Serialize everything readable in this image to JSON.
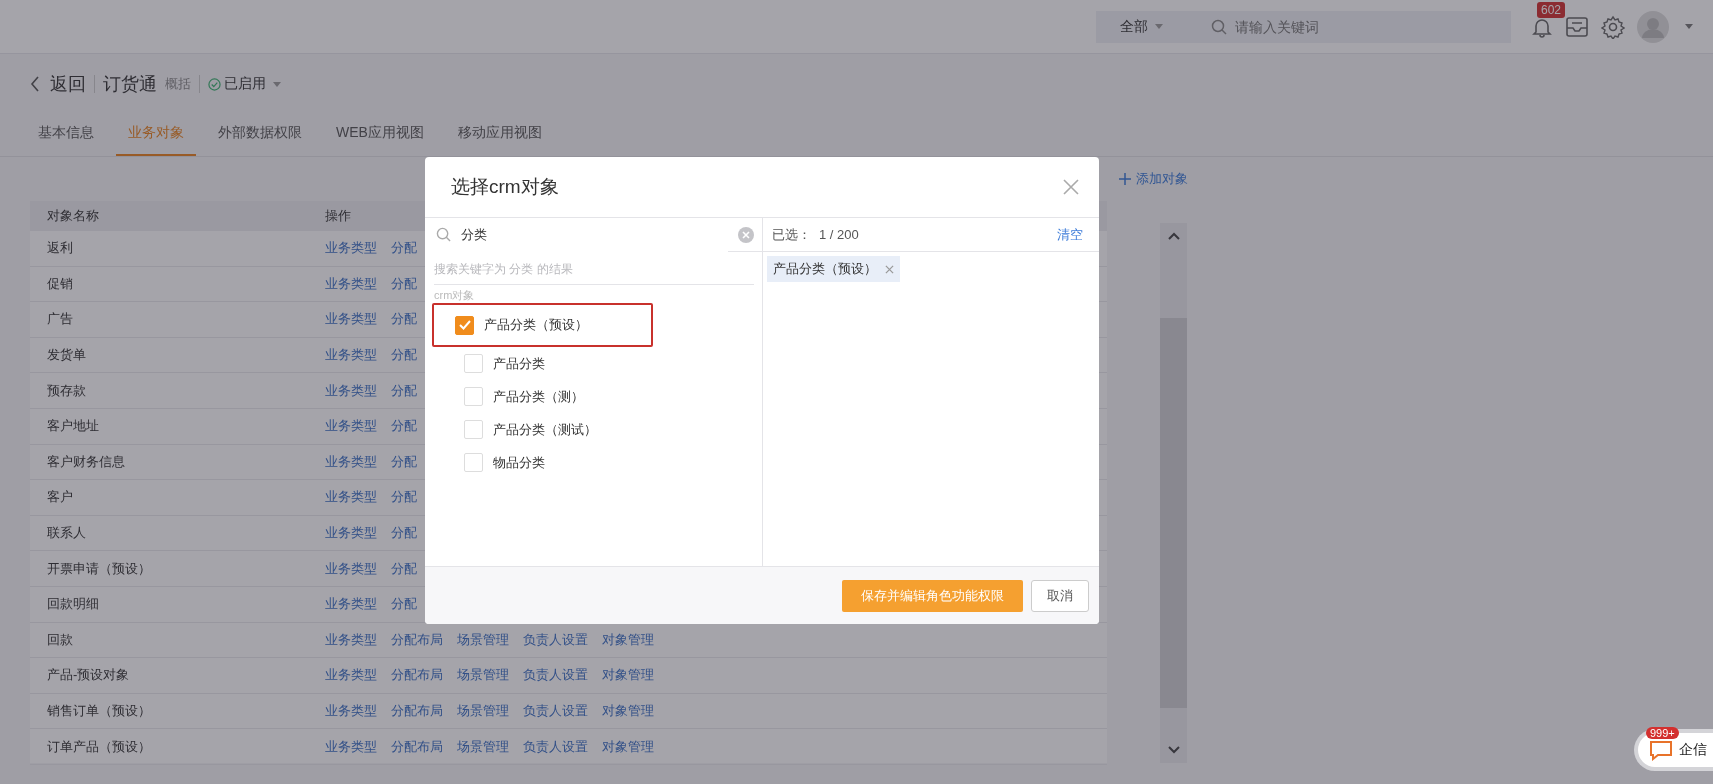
{
  "topbar": {
    "scope": "全部",
    "search_placeholder": "请输入关键词",
    "notification_count": "602"
  },
  "header": {
    "back": "返回",
    "app_name": "订货通",
    "summary": "概括",
    "status": "已启用"
  },
  "tabs": [
    {
      "label": "基本信息",
      "selected": false
    },
    {
      "label": "业务对象",
      "selected": true
    },
    {
      "label": "外部数据权限",
      "selected": false
    },
    {
      "label": "WEB应用视图",
      "selected": false
    },
    {
      "label": "移动应用视图",
      "selected": false
    }
  ],
  "add_object": "添加对象",
  "table": {
    "columns": [
      "对象名称",
      "操作"
    ],
    "rows": [
      {
        "name": "返利",
        "actions": [
          "业务类型",
          "分配"
        ]
      },
      {
        "name": "促销",
        "actions": [
          "业务类型",
          "分配"
        ]
      },
      {
        "name": "广告",
        "actions": [
          "业务类型",
          "分配"
        ]
      },
      {
        "name": "发货单",
        "actions": [
          "业务类型",
          "分配"
        ]
      },
      {
        "name": "预存款",
        "actions": [
          "业务类型",
          "分配"
        ]
      },
      {
        "name": "客户地址",
        "actions": [
          "业务类型",
          "分配"
        ]
      },
      {
        "name": "客户财务信息",
        "actions": [
          "业务类型",
          "分配"
        ]
      },
      {
        "name": "客户",
        "actions": [
          "业务类型",
          "分配"
        ]
      },
      {
        "name": "联系人",
        "actions": [
          "业务类型",
          "分配"
        ]
      },
      {
        "name": "开票申请（预设）",
        "actions": [
          "业务类型",
          "分配"
        ]
      },
      {
        "name": "回款明细",
        "actions": [
          "业务类型",
          "分配"
        ]
      },
      {
        "name": "回款",
        "actions": [
          "业务类型",
          "分配布局",
          "场景管理",
          "负责人设置",
          "对象管理"
        ]
      },
      {
        "name": "产品-预设对象",
        "actions": [
          "业务类型",
          "分配布局",
          "场景管理",
          "负责人设置",
          "对象管理"
        ]
      },
      {
        "name": "销售订单（预设）",
        "actions": [
          "业务类型",
          "分配布局",
          "场景管理",
          "负责人设置",
          "对象管理"
        ]
      },
      {
        "name": "订单产品（预设）",
        "actions": [
          "业务类型",
          "分配布局",
          "场景管理",
          "负责人设置",
          "对象管理"
        ]
      }
    ]
  },
  "dialog": {
    "title": "选择crm对象",
    "search_value": "分类",
    "result_hint": "搜索关键字为 分类 的结果",
    "group_label": "crm对象",
    "options": [
      {
        "label": "产品分类（预设）",
        "checked": true,
        "highlighted": true
      },
      {
        "label": "产品分类",
        "checked": false,
        "highlighted": false
      },
      {
        "label": "产品分类（测）",
        "checked": false,
        "highlighted": false
      },
      {
        "label": "产品分类（测试）",
        "checked": false,
        "highlighted": false
      },
      {
        "label": "物品分类",
        "checked": false,
        "highlighted": false
      }
    ],
    "selected_label": "已选：",
    "selected_count": "1 / 200",
    "clear": "清空",
    "chips": [
      {
        "label": "产品分类（预设）"
      }
    ],
    "save_button": "保存并编辑角色功能权限",
    "cancel_button": "取消"
  },
  "chat_widget": {
    "badge": "999+",
    "label": "企信"
  }
}
